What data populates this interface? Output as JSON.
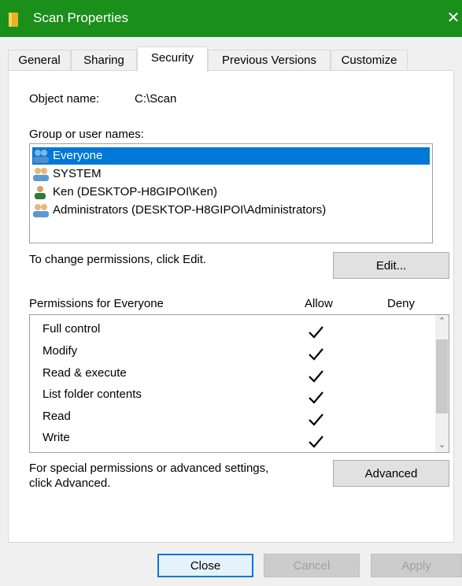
{
  "window": {
    "title": "Scan Properties",
    "close_glyph": "✕"
  },
  "tabs": [
    {
      "label": "General"
    },
    {
      "label": "Sharing"
    },
    {
      "label": "Security"
    },
    {
      "label": "Previous Versions"
    },
    {
      "label": "Customize"
    }
  ],
  "object": {
    "label": "Object name:",
    "value": "C:\\Scan"
  },
  "groups": {
    "label": "Group or user names:",
    "items": [
      {
        "label": "Everyone",
        "icon": "group-icon"
      },
      {
        "label": "SYSTEM",
        "icon": "group-icon"
      },
      {
        "label": "Ken (DESKTOP-H8GIPOI\\Ken)",
        "icon": "user-icon"
      },
      {
        "label": "Administrators (DESKTOP-H8GIPOI\\Administrators)",
        "icon": "group-icon"
      }
    ]
  },
  "change_hint": "To change permissions, click Edit.",
  "edit_label": "Edit...",
  "permissions": {
    "header": "Permissions for Everyone",
    "allow_header": "Allow",
    "deny_header": "Deny",
    "rows": [
      {
        "label": "Full control"
      },
      {
        "label": "Modify"
      },
      {
        "label": "Read & execute"
      },
      {
        "label": "List folder contents"
      },
      {
        "label": "Read"
      },
      {
        "label": "Write"
      }
    ]
  },
  "advanced": {
    "hint_line1": "For special permissions or advanced settings,",
    "hint_line2": "click Advanced.",
    "button_label": "Advanced"
  },
  "footer": {
    "close_label": "Close",
    "cancel_label": "Cancel",
    "apply_label": "Apply"
  },
  "colors": {
    "titlebar": "#1a8f1a",
    "selection": "#0078d7"
  }
}
